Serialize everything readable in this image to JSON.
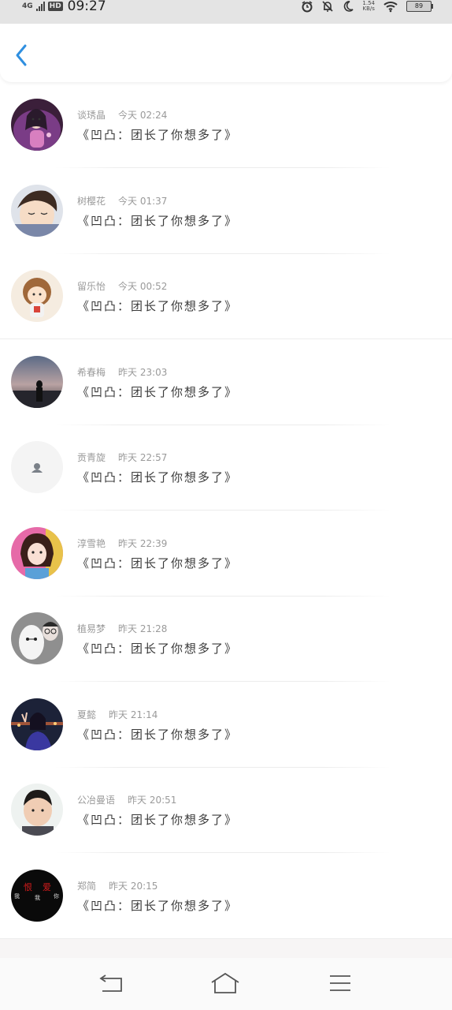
{
  "status_bar": {
    "network": "4G",
    "hd_badge": "HD",
    "time": "09:27",
    "speed_value": "1.54",
    "speed_unit": "KB/s",
    "battery": "89"
  },
  "header": {
    "back_icon": "chevron-left-icon",
    "accent_color": "#2f8fe0"
  },
  "message_text": "《凹凸：团长了你想多了》",
  "items": [
    {
      "name": "谈琇晶",
      "time": "今天 02:24",
      "avatar": "avatar-anime-princess"
    },
    {
      "name": "树樱花",
      "time": "今天 01:37",
      "avatar": "avatar-anime-boy"
    },
    {
      "name": "留乐怡",
      "time": "今天 00:52",
      "avatar": "avatar-cartoon-girl"
    },
    {
      "name": "希春梅",
      "time": "昨天 23:03",
      "avatar": "avatar-sunset-silhouette"
    },
    {
      "name": "贡青旋",
      "time": "昨天 22:57",
      "avatar": "avatar-default-placeholder"
    },
    {
      "name": "淳雪艳",
      "time": "昨天 22:39",
      "avatar": "avatar-girl-photo"
    },
    {
      "name": "植易梦",
      "time": "昨天 21:28",
      "avatar": "avatar-baymax"
    },
    {
      "name": "夏懿",
      "time": "昨天 21:14",
      "avatar": "avatar-night-photo"
    },
    {
      "name": "公冶曼语",
      "time": "昨天 20:51",
      "avatar": "avatar-boy-photo"
    },
    {
      "name": "郑简",
      "time": "昨天 20:15",
      "avatar": "avatar-dark-text"
    }
  ],
  "avatar_texts": {
    "dark_left": "我",
    "dark_red_1": "恨",
    "dark_mid": "我",
    "dark_red_2": "爱",
    "dark_right": "你"
  },
  "nav_bar": {
    "back_icon": "back-arrow-icon",
    "home_icon": "home-icon",
    "menu_icon": "menu-icon"
  }
}
